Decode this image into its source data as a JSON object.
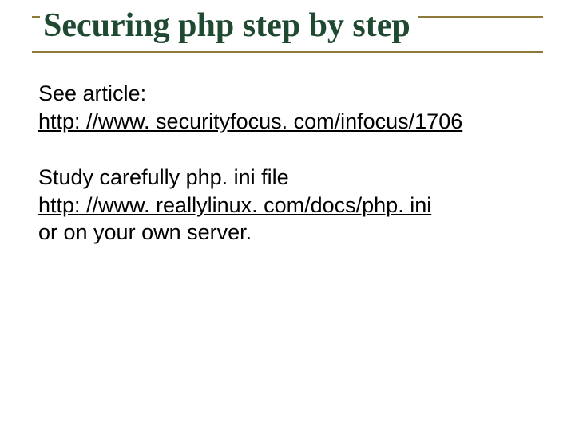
{
  "heading": "Securing php step by step",
  "para1": {
    "line1": "See article:",
    "link": "http: //www. securityfocus. com/infocus/1706"
  },
  "para2": {
    "line1": "Study carefully php. ini file",
    "link": "http: //www. reallylinux. com/docs/php. ini",
    "line3": "or on your own server."
  }
}
